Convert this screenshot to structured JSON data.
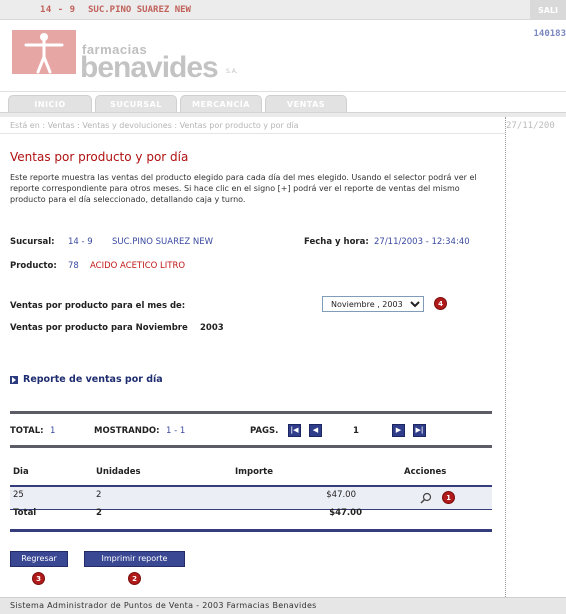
{
  "top_bar": {
    "branch_code": "14 - 9",
    "branch_name": "SUC.PINO SUAREZ NEW",
    "logout_label": "SALI"
  },
  "header": {
    "logo_small": "farmacias",
    "logo_big": "benavides",
    "logo_tm": "S.A.",
    "session_number": "140183"
  },
  "tabs": [
    {
      "label": "INICIO"
    },
    {
      "label": "SUCURSAL"
    },
    {
      "label": "MERCANCÍA"
    },
    {
      "label": "VENTAS"
    }
  ],
  "breadcrumb": "Está en : Ventas : Ventas y devoluciones : Ventas por producto y por día",
  "right_date": "27/11/200",
  "page": {
    "title": "Ventas por producto y por día",
    "description": "Este reporte muestra las ventas del producto elegido para cada día del mes elegido. Usando el selector podrá ver el reporte correspondiente para otros meses. Si hace clic en el signo [+] podrá ver el reporte de ventas del mismo producto para el día seleccionado, detallando caja y turno.",
    "sucursal_label": "Sucursal:",
    "sucursal_code": "14 - 9",
    "sucursal_name": "SUC.PINO SUAREZ NEW",
    "fecha_label": "Fecha y hora:",
    "fecha_value": "27/11/2003 - 12:34:40",
    "producto_label": "Producto:",
    "producto_code": "78",
    "producto_name": "ACIDO ACETICO LITRO",
    "month_prompt": "Ventas por producto para el mes de:",
    "month_selected": "Noviembre , 2003",
    "month_caption_prefix": "Ventas por producto para Noviembre",
    "month_caption_year": "2003",
    "section_link": "Reporte de ventas por día"
  },
  "pagination": {
    "total_label": "TOTAL:",
    "total_value": "1",
    "showing_label": "MOSTRANDO:",
    "showing_value": "1 - 1",
    "pages_label": "PAGS.",
    "current_page": "1"
  },
  "table": {
    "headers": [
      "Dia",
      "Unidades",
      "Importe",
      "Acciones"
    ],
    "rows": [
      {
        "dia": "25",
        "unidades": "2",
        "importe": "$47.00"
      }
    ],
    "total_label": "Total",
    "total_unidades": "2",
    "total_importe": "$47.00"
  },
  "buttons": {
    "back": "Regresar",
    "print": "Imprimir reporte"
  },
  "badges": {
    "select": "4",
    "action": "1",
    "print": "2",
    "back": "3"
  },
  "footer": "Sistema Administrador de Puntos de Venta - 2003 Farmacias Benavides",
  "colors": {
    "accent_red": "#b01010",
    "nav_blue": "#2f3d8a",
    "value_blue": "#3a4aa0",
    "badge_red": "#b11a1a"
  }
}
